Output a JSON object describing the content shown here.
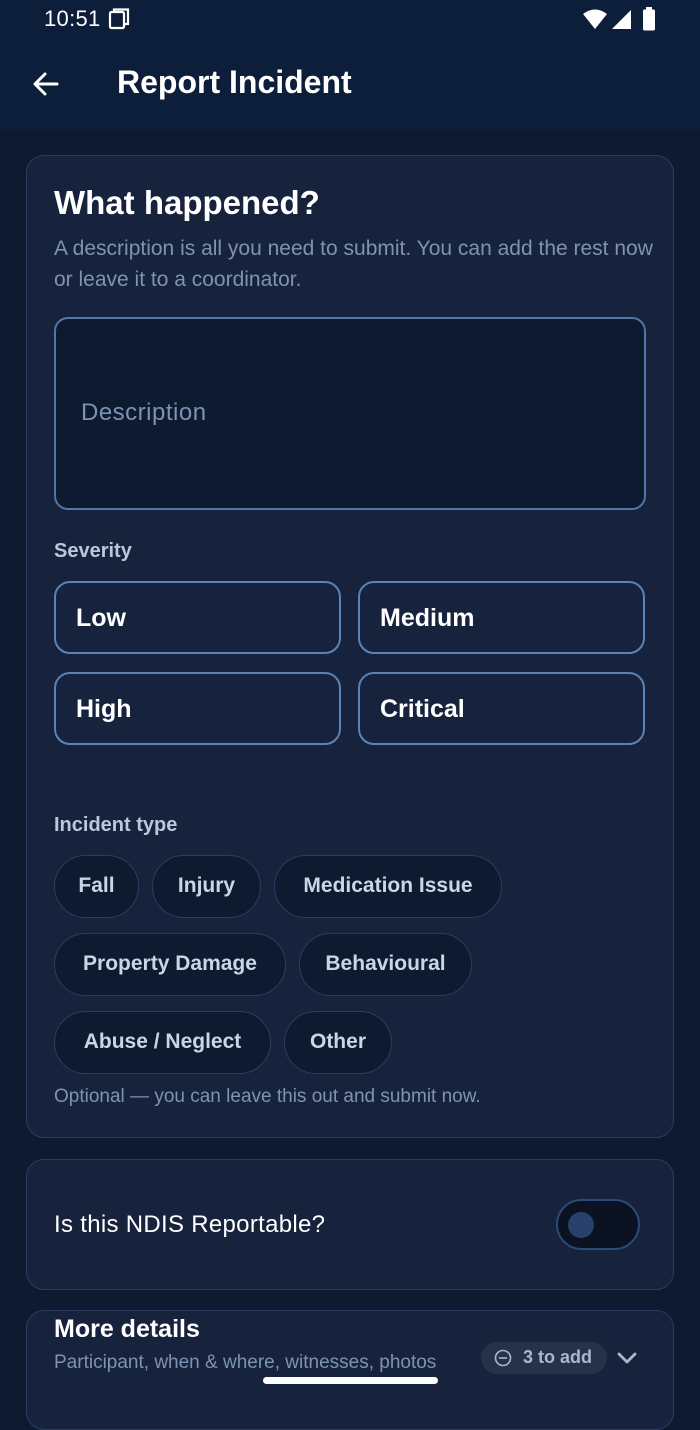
{
  "status_bar": {
    "time": "10:51"
  },
  "app_bar": {
    "title": "Report Incident",
    "back_icon": "arrow-left-icon"
  },
  "form": {
    "heading": "What happened?",
    "subtext": "A description is all you need to submit. You can add the rest now or leave it to a coordinator.",
    "description_placeholder": "Description",
    "severity": {
      "label": "Severity",
      "options": [
        "Low",
        "Medium",
        "High",
        "Critical"
      ]
    },
    "incident_type": {
      "label": "Incident type",
      "options": [
        "Fall",
        "Injury",
        "Medication Issue",
        "Property Damage",
        "Behavioural",
        "Abuse / Neglect",
        "Other"
      ],
      "helper": "Optional — you can leave this out and submit now."
    }
  },
  "ndis": {
    "label": "Is this NDIS Reportable?",
    "toggle_on": false
  },
  "more_details": {
    "title": "More details",
    "subtitle": "Participant, when & where, witnesses, photos",
    "badge": "3 to add"
  },
  "colors": {
    "background": "#0e1a2f",
    "app_bar": "#0d1e3a",
    "card": "#17233d",
    "accent_border": "#5a83b6",
    "muted_text": "#7d93b3"
  }
}
